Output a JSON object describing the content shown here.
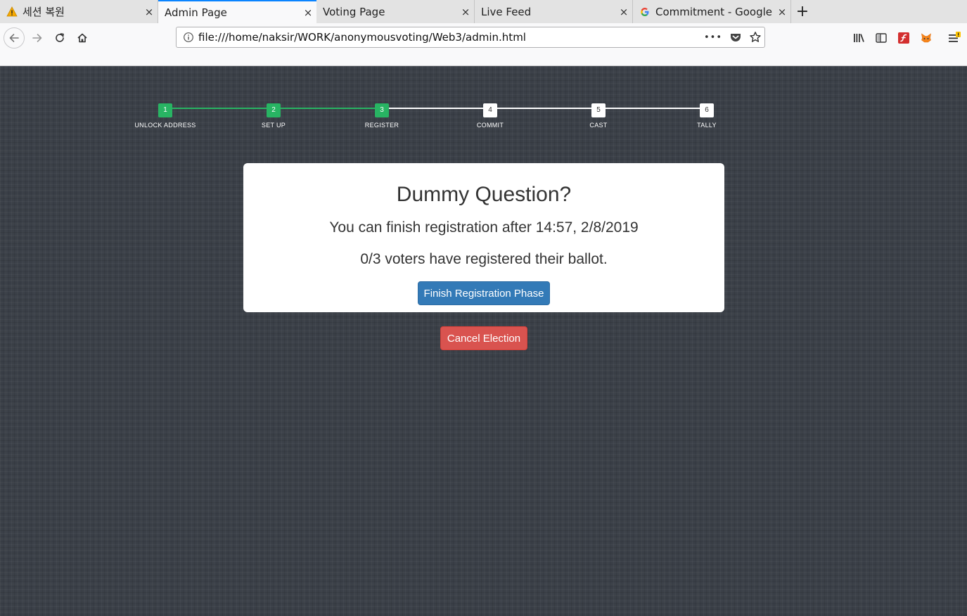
{
  "browser": {
    "tabs": [
      {
        "title": "세션 복원",
        "icon": "warning-icon",
        "active": false
      },
      {
        "title": "Admin Page",
        "icon": "",
        "active": true
      },
      {
        "title": "Voting Page",
        "icon": "",
        "active": false
      },
      {
        "title": "Live Feed",
        "icon": "",
        "active": false
      },
      {
        "title": "Commitment - Google 검",
        "icon": "google-icon",
        "active": false
      }
    ],
    "new_tab_label": "+",
    "close_label": "×",
    "url": "file:///home/naksir/WORK/anonymousvoting/Web3/admin.html",
    "more_label": "•••"
  },
  "stepper": {
    "current_step": 3,
    "steps": [
      {
        "num": "1",
        "label": "UNLOCK ADDRESS"
      },
      {
        "num": "2",
        "label": "SET UP"
      },
      {
        "num": "3",
        "label": "REGISTER"
      },
      {
        "num": "4",
        "label": "COMMIT"
      },
      {
        "num": "5",
        "label": "CAST"
      },
      {
        "num": "6",
        "label": "TALLY"
      }
    ]
  },
  "card": {
    "question": "Dummy Question?",
    "deadline": "You can finish registration after 14:57, 2/8/2019",
    "registered": "0/3 voters have registered their ballot.",
    "finish_button": "Finish Registration Phase"
  },
  "cancel_button": "Cancel Election",
  "colors": {
    "done": "#28b463",
    "primary": "#337ab7",
    "danger": "#d9534f",
    "tab_accent": "#0a84ff"
  }
}
